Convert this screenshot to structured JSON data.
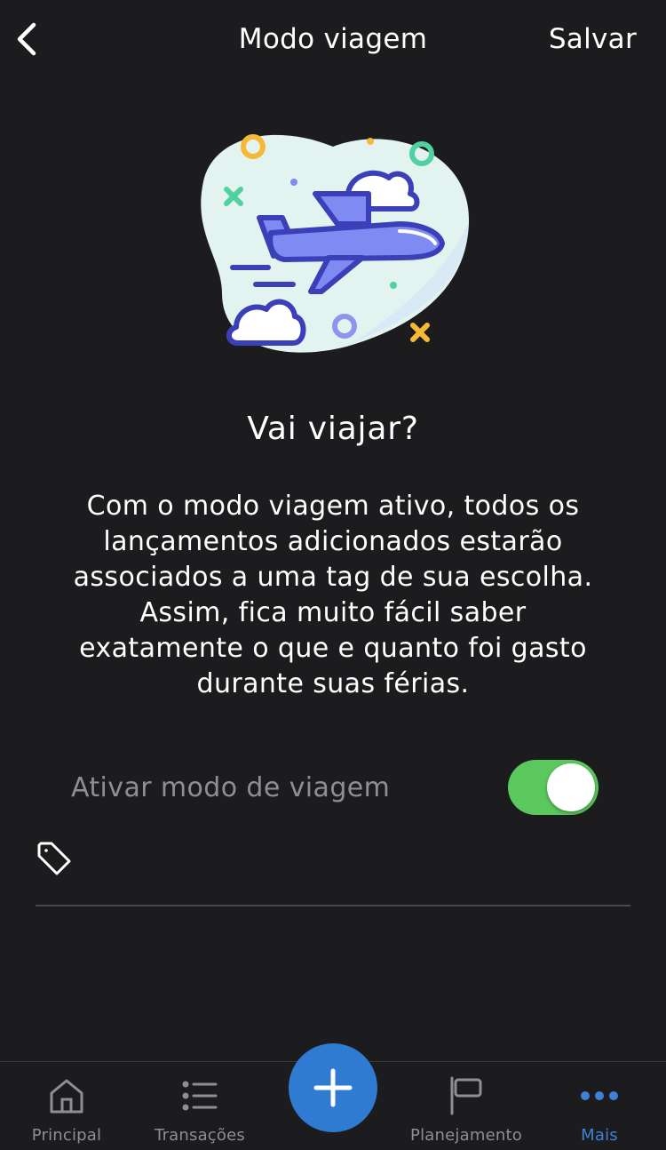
{
  "header": {
    "title": "Modo viagem",
    "save_label": "Salvar",
    "back_icon": "chevron-left-icon"
  },
  "illustration": {
    "subject": "airplane-clouds-illustration",
    "colors": {
      "blob": "#e3f3f0",
      "plane_stroke": "#3b3fb8",
      "plane_fill": "#7f8bf2",
      "accent_yellow": "#f5b936",
      "accent_green": "#4fd1a0"
    }
  },
  "content": {
    "headline": "Vai viajar?",
    "description": "Com o modo viagem ativo, todos os lançamentos adicionados estarão associados a uma tag de sua escolha. Assim, fica muito fácil saber exatamente o que e quanto foi gasto durante suas férias."
  },
  "travel_mode": {
    "label": "Ativar modo de viagem",
    "enabled": true,
    "switch_color": "#5ac85c"
  },
  "tag_field": {
    "icon": "tag-icon",
    "value": ""
  },
  "tabbar": {
    "items": [
      {
        "label": "Principal",
        "icon": "home-icon",
        "active": false
      },
      {
        "label": "Transações",
        "icon": "list-icon",
        "active": false
      },
      {
        "label": "Planejamento",
        "icon": "flag-icon",
        "active": false
      },
      {
        "label": "Mais",
        "icon": "more-dots-icon",
        "active": true
      }
    ],
    "add_button_icon": "plus-icon",
    "active_color": "#3d82d6",
    "fab_color": "#2f7bd2"
  }
}
